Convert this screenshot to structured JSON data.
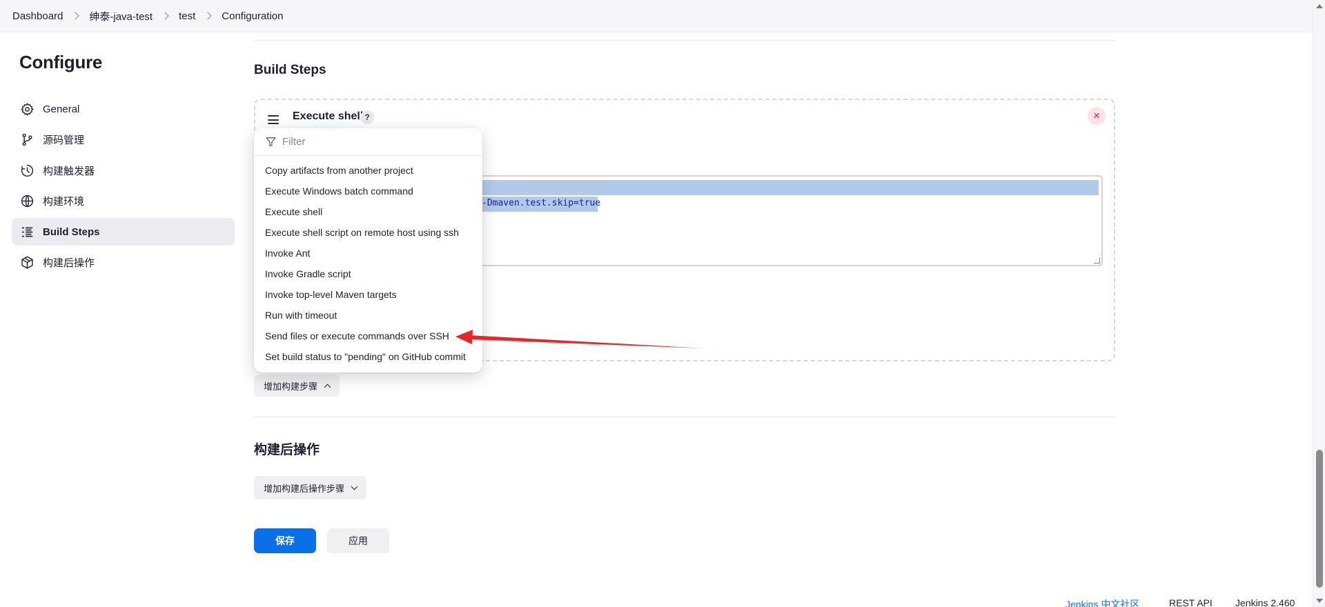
{
  "breadcrumb": [
    "Dashboard",
    "绅泰-java-test",
    "test",
    "Configuration"
  ],
  "sidebar": {
    "title": "Configure",
    "items": [
      {
        "label": "General",
        "icon": "gear-icon"
      },
      {
        "label": "源码管理",
        "icon": "branch-icon"
      },
      {
        "label": "构建触发器",
        "icon": "clock-icon"
      },
      {
        "label": "构建环境",
        "icon": "globe-icon"
      },
      {
        "label": "Build Steps",
        "icon": "list-icon",
        "active": true
      },
      {
        "label": "构建后操作",
        "icon": "package-icon"
      }
    ]
  },
  "build_steps": {
    "title": "Build Steps",
    "step": {
      "name": "Execute shell",
      "help": "?",
      "close": "×",
      "command_fragment": "-Dmaven.test.skip=true"
    },
    "add_button": "增加构建步骤"
  },
  "dropdown": {
    "filter_placeholder": "Filter",
    "items": [
      "Copy artifacts from another project",
      "Execute Windows batch command",
      "Execute shell",
      "Execute shell script on remote host using ssh",
      "Invoke Ant",
      "Invoke Gradle script",
      "Invoke top-level Maven targets",
      "Run with timeout",
      "Send files or execute commands over SSH",
      "Set build status to \"pending\" on GitHub commit"
    ]
  },
  "post_build": {
    "title": "构建后操作",
    "add_button": "增加构建后操作步骤"
  },
  "actions": {
    "save": "保存",
    "apply": "应用"
  },
  "footer": {
    "community": "Jenkins 中文社区",
    "rest_api": "REST API",
    "version": "Jenkins 2.460"
  },
  "colors": {
    "accent": "#0b6fe8",
    "annotation_arrow": "#e8262a",
    "selection": "#b3c9ea"
  }
}
